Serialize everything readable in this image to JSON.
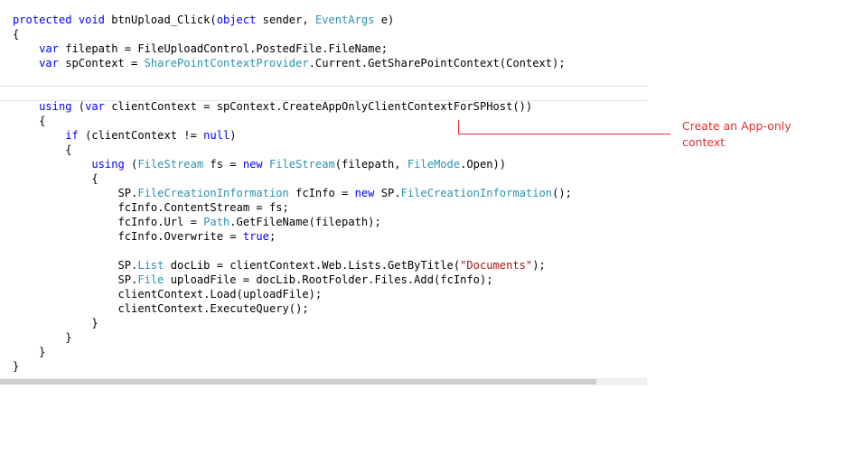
{
  "code": {
    "l1": {
      "kw1": "protected",
      "kw2": "void",
      "t1": " btnUpload_Click(",
      "kw3": "object",
      "t2": " sender, ",
      "ty1": "EventArgs",
      "t3": " e)"
    },
    "l2": "{",
    "l3": {
      "kw1": "var",
      "t1": " filepath = FileUploadControl.PostedFile.FileName;"
    },
    "l4": {
      "kw1": "var",
      "t1": " spContext = ",
      "ty1": "SharePointContextProvider",
      "t2": ".Current.GetSharePointContext(Context);"
    },
    "l5": {
      "kw1": "using",
      "t1": " (",
      "kw2": "var",
      "t2": " clientContext = spContext.CreateAppOnlyClientContextForSPHost())"
    },
    "l6": "{",
    "l7": {
      "kw1": "if",
      "t1": " (clientContext != ",
      "kw2": "null",
      "t2": ")"
    },
    "l8": "{",
    "l9": {
      "kw1": "using",
      "t1": " (",
      "ty1": "FileStream",
      "t2": " fs = ",
      "kw2": "new",
      "t3": " ",
      "ty2": "FileStream",
      "t4": "(filepath, ",
      "ty3": "FileMode",
      "t5": ".Open))"
    },
    "l10": "{",
    "l11": {
      "t1": "SP.",
      "ty1": "FileCreationInformation",
      "t2": " fcInfo = ",
      "kw1": "new",
      "t3": " SP.",
      "ty2": "FileCreationInformation",
      "t4": "();"
    },
    "l12": "fcInfo.ContentStream = fs;",
    "l13": {
      "t1": "fcInfo.Url = ",
      "ty1": "Path",
      "t2": ".GetFileName(filepath);"
    },
    "l14": {
      "t1": "fcInfo.Overwrite = ",
      "kw1": "true",
      "t2": ";"
    },
    "l15": {
      "t1": "SP.",
      "ty1": "List",
      "t2": " docLib = clientContext.Web.Lists.GetByTitle(",
      "st1": "\"Documents\"",
      "t3": ");"
    },
    "l16": {
      "t1": "SP.",
      "ty1": "File",
      "t2": " uploadFile = docLib.RootFolder.Files.Add(fcInfo);"
    },
    "l17": "clientContext.Load(uploadFile);",
    "l18": "clientContext.ExecuteQuery();",
    "l19": "}",
    "l20": "}",
    "l21": "}",
    "l22": "}"
  },
  "annotation": {
    "text": "Create an App-only context",
    "color": "#e03030"
  },
  "colors": {
    "keyword": "#0000ff",
    "type": "#2b91af",
    "string": "#a31515"
  }
}
